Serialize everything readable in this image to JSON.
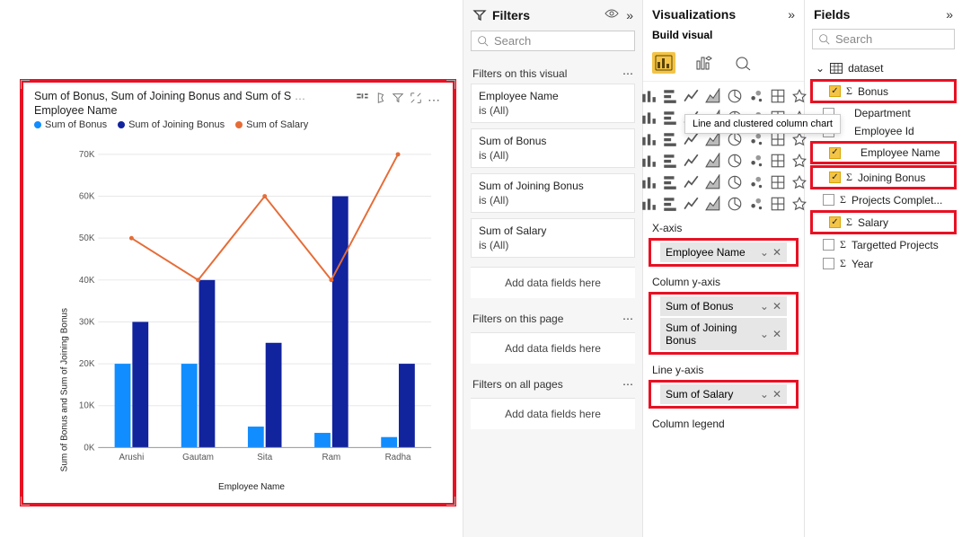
{
  "colors": {
    "series1": "#118DFF",
    "series2": "#12239E",
    "series3": "#E66C37",
    "highlight": "#e81123",
    "accent": "#F3C447"
  },
  "chart": {
    "title": "Sum of Bonus, Sum of Joining Bonus and Sum of Salary by Employee Name",
    "title_truncated": "Sum of Bonus, Sum of Joining Bonus and Sum of S",
    "title_line2": "Employee Name",
    "legend": [
      "Sum of Bonus",
      "Sum of Joining Bonus",
      "Sum of Salary"
    ],
    "y_label": "Sum of Bonus and Sum of Joining Bonus",
    "x_label": "Employee Name",
    "y_ticks": [
      "0K",
      "10K",
      "20K",
      "30K",
      "40K",
      "50K",
      "60K",
      "70K"
    ],
    "categories": [
      "Arushi",
      "Gautam",
      "Sita",
      "Ram",
      "Radha"
    ]
  },
  "chart_data": {
    "type": "line-and-clustered-column",
    "categories": [
      "Arushi",
      "Gautam",
      "Sita",
      "Ram",
      "Radha"
    ],
    "column_series": [
      {
        "name": "Sum of Bonus",
        "values": [
          20000,
          20000,
          5000,
          3500,
          2500
        ]
      },
      {
        "name": "Sum of Joining Bonus",
        "values": [
          30000,
          40000,
          25000,
          60000,
          20000
        ]
      }
    ],
    "line_series": [
      {
        "name": "Sum of Salary",
        "values": [
          50000,
          40000,
          60000,
          40000,
          70000
        ]
      }
    ],
    "ylim": [
      0,
      70000
    ],
    "xlabel": "Employee Name",
    "ylabel": "Sum of Bonus and Sum of Joining Bonus"
  },
  "filters": {
    "pane_title": "Filters",
    "search_placeholder": "Search",
    "sections": {
      "visual": {
        "title": "Filters on this visual"
      },
      "page": {
        "title": "Filters on this page"
      },
      "all": {
        "title": "Filters on all pages"
      }
    },
    "cards": [
      {
        "name": "Employee Name",
        "value": "is (All)"
      },
      {
        "name": "Sum of Bonus",
        "value": "is (All)"
      },
      {
        "name": "Sum of Joining Bonus",
        "value": "is (All)"
      },
      {
        "name": "Sum of Salary",
        "value": "is (All)"
      }
    ],
    "placeholder": "Add data fields here"
  },
  "viz": {
    "pane_title": "Visualizations",
    "subtitle": "Build visual",
    "tooltip": "Line and clustered column chart",
    "wells": {
      "xaxis": {
        "label": "X-axis",
        "items": [
          "Employee Name"
        ]
      },
      "col_y": {
        "label": "Column y-axis",
        "items": [
          "Sum of Bonus",
          "Sum of Joining Bonus"
        ]
      },
      "line_y": {
        "label": "Line y-axis",
        "items": [
          "Sum of Salary"
        ]
      },
      "col_legend": {
        "label": "Column legend"
      }
    }
  },
  "fields": {
    "pane_title": "Fields",
    "search_placeholder": "Search",
    "table": "dataset",
    "items": [
      {
        "name": "Bonus",
        "checked": true,
        "sigma": true,
        "hl": true
      },
      {
        "name": "Department",
        "checked": false,
        "sigma": false
      },
      {
        "name": "Employee Id",
        "checked": false,
        "sigma": false
      },
      {
        "name": "Employee Name",
        "checked": true,
        "sigma": false,
        "hl": true
      },
      {
        "name": "Joining Bonus",
        "checked": true,
        "sigma": true,
        "hl": true
      },
      {
        "name": "Projects Complet...",
        "checked": false,
        "sigma": true
      },
      {
        "name": "Salary",
        "checked": true,
        "sigma": true,
        "hl": true
      },
      {
        "name": "Targetted Projects",
        "checked": false,
        "sigma": true
      },
      {
        "name": "Year",
        "checked": false,
        "sigma": true
      }
    ]
  }
}
